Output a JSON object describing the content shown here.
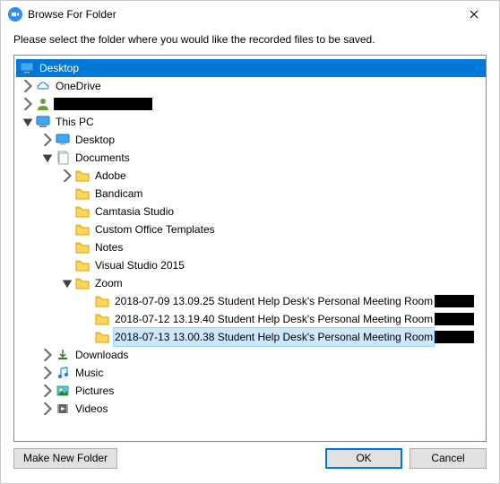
{
  "window": {
    "title": "Browse For Folder",
    "close_name": "close"
  },
  "instruction": "Please select the folder where you would like the recorded files to be saved.",
  "tree": {
    "desktop_root": "Desktop",
    "onedrive": "OneDrive",
    "user": "",
    "this_pc": "This PC",
    "pc_desktop": "Desktop",
    "documents": "Documents",
    "doc_adobe": "Adobe",
    "doc_bandicam": "Bandicam",
    "doc_camtasia": "Camtasia Studio",
    "doc_custom_office": "Custom Office Templates",
    "doc_notes": "Notes",
    "doc_vs2015": "Visual Studio 2015",
    "doc_zoom": "Zoom",
    "zoom_1": "2018-07-09 13.09.25 Student Help Desk's Personal Meeting Room",
    "zoom_2": "2018-07-12 13.19.40 Student Help Desk's Personal Meeting Room",
    "zoom_3": "2018-07-13 13.00.38 Student Help Desk's Personal Meeting Room",
    "downloads": "Downloads",
    "music": "Music",
    "pictures": "Pictures",
    "videos": "Videos"
  },
  "footer": {
    "make_new": "Make New Folder",
    "ok": "OK",
    "cancel": "Cancel"
  }
}
